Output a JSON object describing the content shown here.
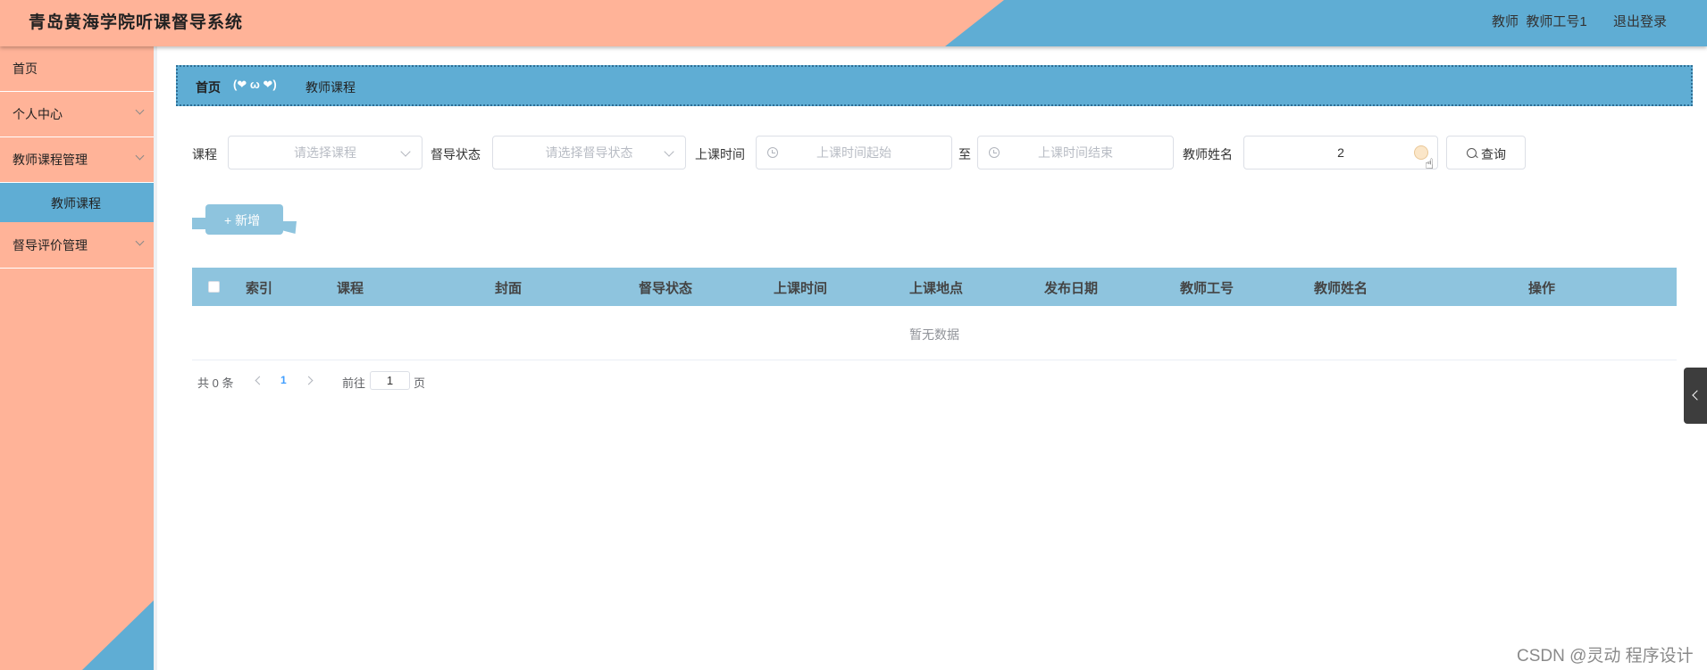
{
  "header": {
    "app_title": "青岛黄海学院听课督导系统",
    "user_role": "教师",
    "user_id": "教师工号1",
    "logout_label": "退出登录",
    "colors": {
      "primary_bg": "#ffb398",
      "accent_blue": "#5fadd4"
    }
  },
  "sidebar": {
    "items": [
      {
        "label": "首页",
        "has_children": false
      },
      {
        "label": "个人中心",
        "has_children": true
      },
      {
        "label": "教师课程管理",
        "has_children": true,
        "expanded": true,
        "children": [
          {
            "label": "教师课程",
            "active": true
          }
        ]
      },
      {
        "label": "督导评价管理",
        "has_children": true
      }
    ]
  },
  "breadcrumb": {
    "home": "首页",
    "separator": "(❤ ω ❤)",
    "current": "教师课程"
  },
  "filters": {
    "course_label": "课程",
    "course_placeholder": "请选择课程",
    "status_label": "督导状态",
    "status_placeholder": "请选择督导状态",
    "time_label": "上课时间",
    "time_start_placeholder": "上课时间起始",
    "time_to": "至",
    "time_end_placeholder": "上课时间结束",
    "teacher_label": "教师姓名",
    "teacher_value": "2",
    "query_button": "查询"
  },
  "toolbar": {
    "add_label": "+ 新增"
  },
  "table": {
    "columns": [
      "索引",
      "课程",
      "封面",
      "督导状态",
      "上课时间",
      "上课地点",
      "发布日期",
      "教师工号",
      "教师姓名",
      "操作"
    ],
    "rows": [],
    "empty_text": "暂无数据"
  },
  "pagination": {
    "total_text": "共 0 条",
    "current_page": "1",
    "goto_label": "前往",
    "goto_value": "1",
    "page_suffix": "页"
  },
  "watermark": "CSDN @灵动 程序设计"
}
